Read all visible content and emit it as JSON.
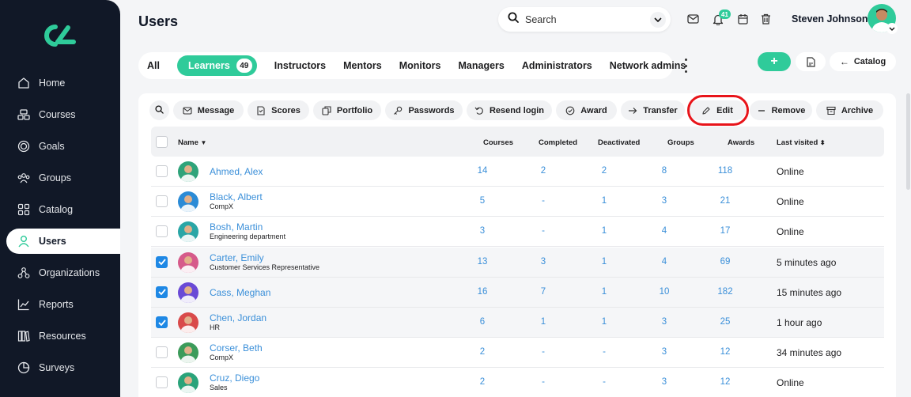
{
  "sidebar": {
    "items": [
      {
        "label": "Home",
        "icon": "home-icon"
      },
      {
        "label": "Courses",
        "icon": "courses-icon"
      },
      {
        "label": "Goals",
        "icon": "goals-icon"
      },
      {
        "label": "Groups",
        "icon": "groups-icon"
      },
      {
        "label": "Catalog",
        "icon": "catalog-icon"
      },
      {
        "label": "Users",
        "icon": "user-icon",
        "active": true
      },
      {
        "label": "Organizations",
        "icon": "organizations-icon"
      },
      {
        "label": "Reports",
        "icon": "reports-icon"
      },
      {
        "label": "Resources",
        "icon": "resources-icon"
      },
      {
        "label": "Surveys",
        "icon": "surveys-icon"
      }
    ]
  },
  "header": {
    "title": "Users",
    "search_label": "Search",
    "notification_count": "41",
    "user_name": "Steven Johnson"
  },
  "tabs": [
    {
      "label": "All"
    },
    {
      "label": "Learners",
      "count": "49",
      "active": true
    },
    {
      "label": "Instructors"
    },
    {
      "label": "Mentors"
    },
    {
      "label": "Monitors"
    },
    {
      "label": "Managers"
    },
    {
      "label": "Administrators"
    },
    {
      "label": "Network admins"
    }
  ],
  "buttons": {
    "add": "+",
    "catalog": "Catalog"
  },
  "actions": [
    {
      "label": "Message"
    },
    {
      "label": "Scores"
    },
    {
      "label": "Portfolio"
    },
    {
      "label": "Passwords"
    },
    {
      "label": "Resend login"
    },
    {
      "label": "Award"
    },
    {
      "label": "Transfer"
    },
    {
      "label": "Edit"
    },
    {
      "label": "Remove"
    },
    {
      "label": "Archive"
    }
  ],
  "table": {
    "columns": {
      "name": "Name",
      "courses": "Courses",
      "completed": "Completed",
      "deactivated": "Deactivated",
      "groups": "Groups",
      "awards": "Awards",
      "last_visited": "Last visited"
    },
    "rows": [
      {
        "name": "Ahmed, Alex",
        "dept": "",
        "courses": "14",
        "completed": "2",
        "deactivated": "2",
        "groups": "8",
        "awards": "118",
        "last_visited": "Online",
        "checked": false
      },
      {
        "name": "Black, Albert",
        "dept": "CompX",
        "courses": "5",
        "completed": "-",
        "deactivated": "1",
        "groups": "3",
        "awards": "21",
        "last_visited": "Online",
        "checked": false
      },
      {
        "name": "Bosh, Martin",
        "dept": "Engineering department",
        "courses": "3",
        "completed": "-",
        "deactivated": "1",
        "groups": "4",
        "awards": "17",
        "last_visited": "Online",
        "checked": false
      },
      {
        "name": "Carter, Emily",
        "dept": "Customer Services Representative",
        "courses": "13",
        "completed": "3",
        "deactivated": "1",
        "groups": "4",
        "awards": "69",
        "last_visited": "5 minutes ago",
        "checked": true
      },
      {
        "name": "Cass, Meghan",
        "dept": "",
        "courses": "16",
        "completed": "7",
        "deactivated": "1",
        "groups": "10",
        "awards": "182",
        "last_visited": "15 minutes ago",
        "checked": true
      },
      {
        "name": "Chen, Jordan",
        "dept": "HR",
        "courses": "6",
        "completed": "1",
        "deactivated": "1",
        "groups": "3",
        "awards": "25",
        "last_visited": "1 hour ago",
        "checked": true
      },
      {
        "name": "Corser, Beth",
        "dept": "CompX",
        "courses": "2",
        "completed": "-",
        "deactivated": "-",
        "groups": "3",
        "awards": "12",
        "last_visited": "34 minutes ago",
        "checked": false
      },
      {
        "name": "Cruz, Diego",
        "dept": "Sales",
        "courses": "2",
        "completed": "-",
        "deactivated": "-",
        "groups": "3",
        "awards": "12",
        "last_visited": "Online",
        "checked": false
      }
    ]
  },
  "colors": {
    "accent": "#2fcb9a",
    "sidebar": "#111827",
    "link": "#3a8fd9",
    "checkbox": "#1e88e5",
    "highlight_ring": "#e8141a"
  }
}
